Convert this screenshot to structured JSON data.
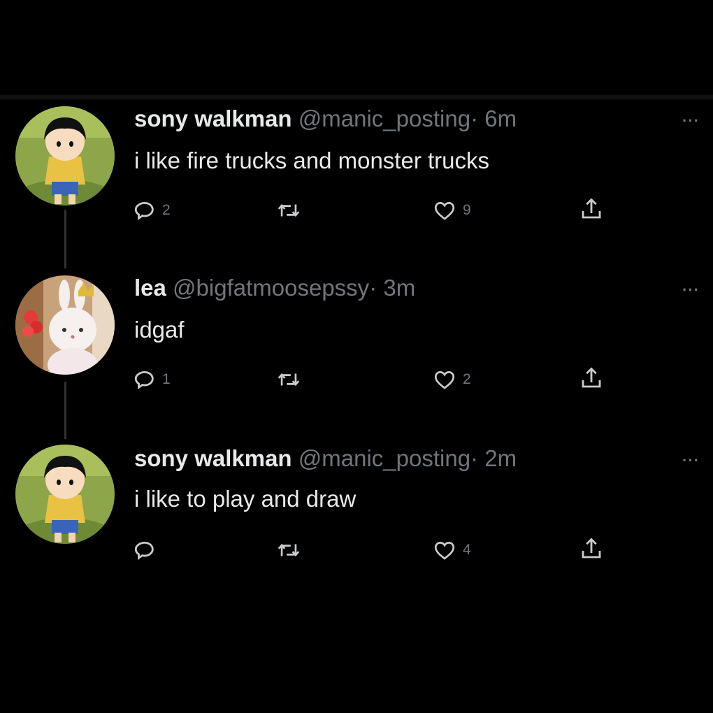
{
  "tweets": [
    {
      "name": "sony walkman",
      "handle": "@manic_posting",
      "separator": "·",
      "time": "6m",
      "text": "i like fire trucks and monster trucks",
      "replies": "2",
      "retweets": "",
      "likes": "9",
      "more": "···"
    },
    {
      "name": "lea",
      "handle": "@bigfatmoosepssy",
      "separator": "·",
      "time": "3m",
      "text": "idgaf",
      "replies": "1",
      "retweets": "",
      "likes": "2",
      "more": "···"
    },
    {
      "name": "sony walkman",
      "handle": "@manic_posting",
      "separator": "·",
      "time": "2m",
      "text": "i like to play and draw",
      "replies": "",
      "retweets": "",
      "likes": "4",
      "more": "···"
    }
  ],
  "colors": {
    "background": "#000000",
    "primary_text": "#e7e9ea",
    "secondary_text": "#71767b",
    "thread_line": "#2f3336"
  },
  "icons": {
    "reply": "reply-icon",
    "retweet": "retweet-icon",
    "like": "heart-icon",
    "share": "share-icon",
    "more": "more-options-icon"
  }
}
